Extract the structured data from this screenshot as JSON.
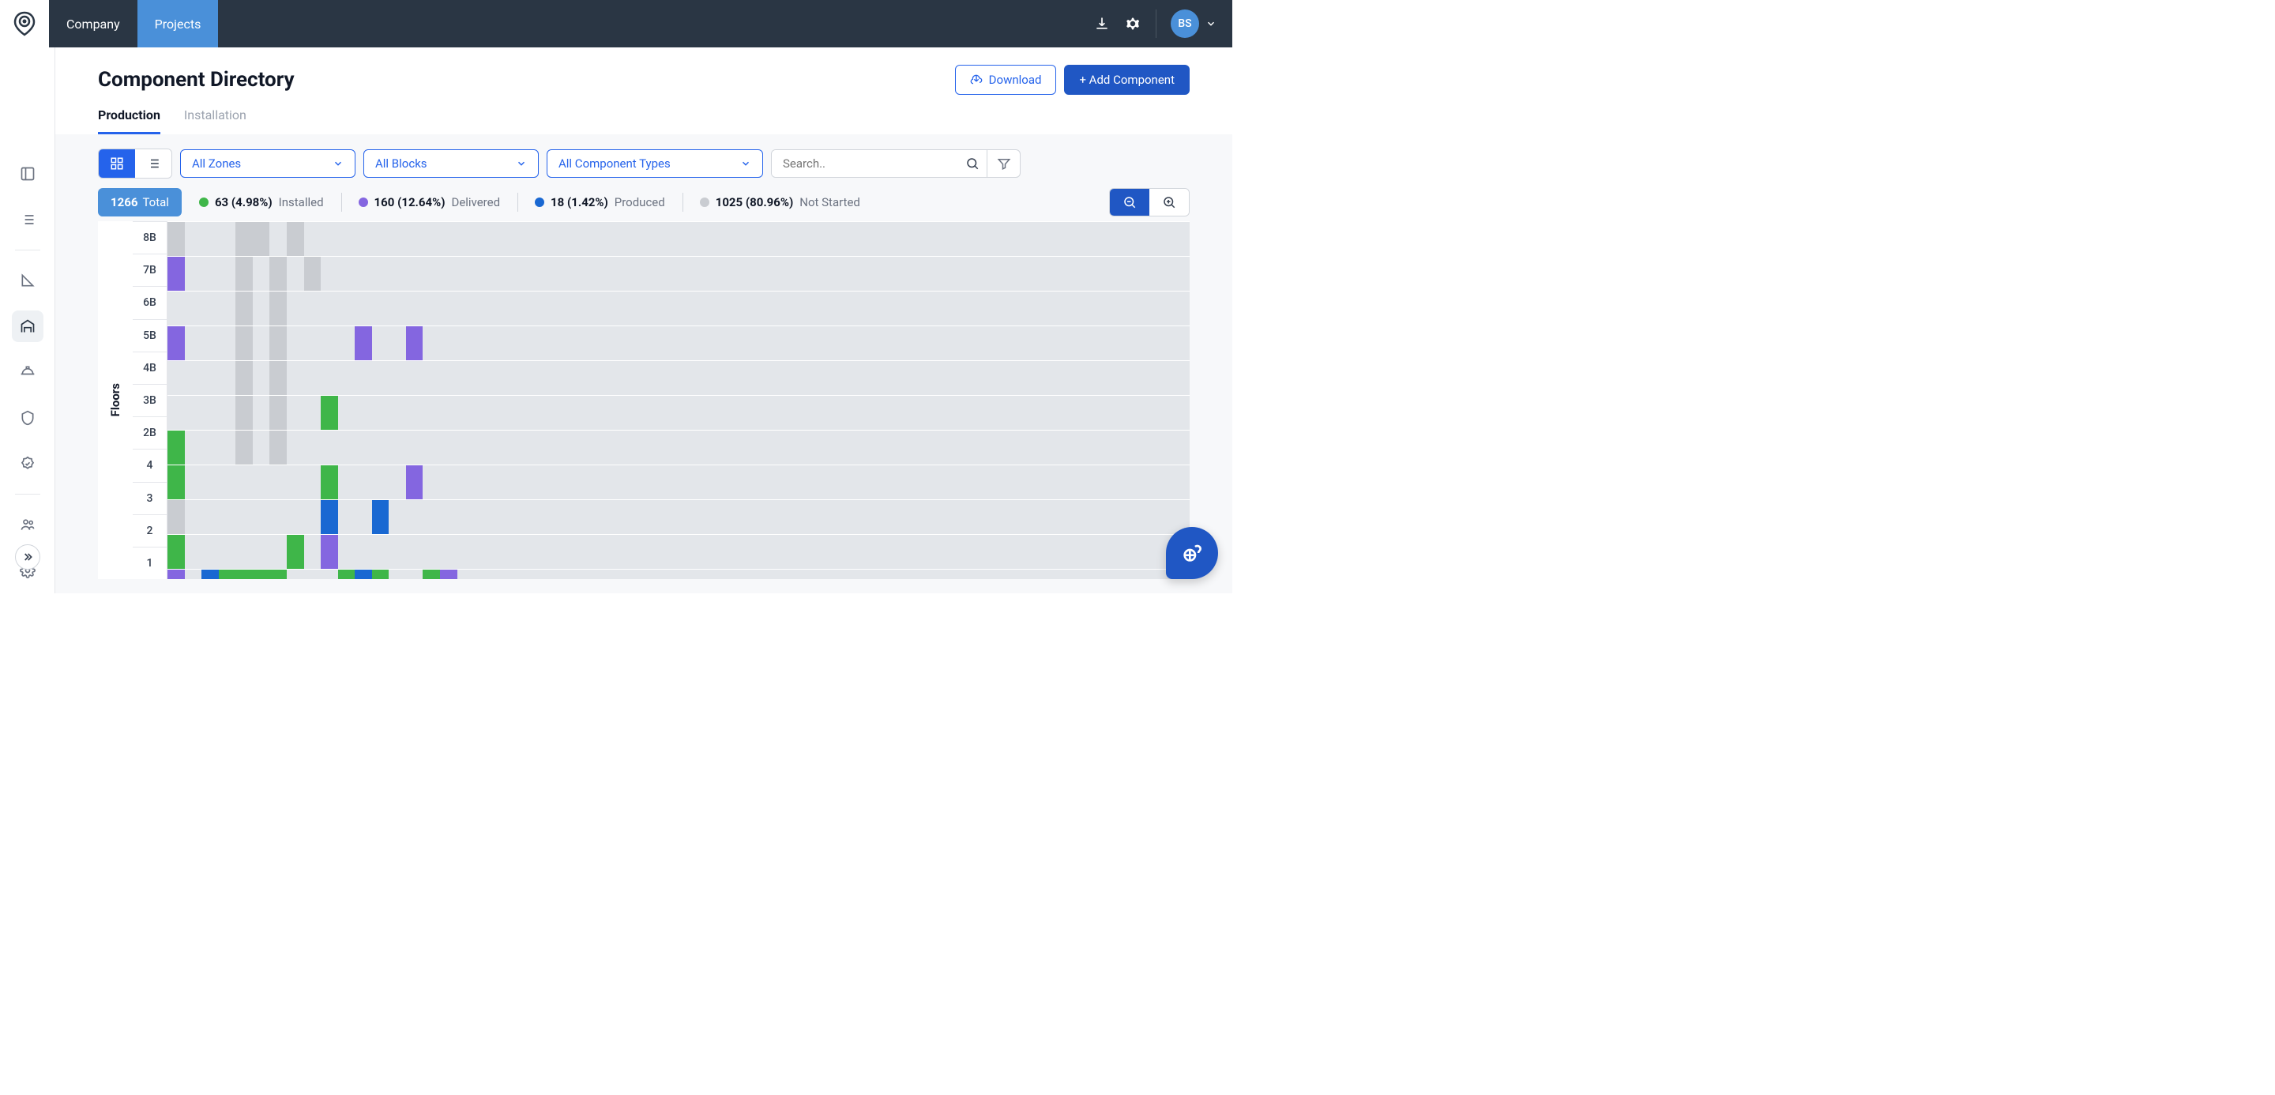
{
  "colors": {
    "installed": "#3fb649",
    "delivered": "#8466e0",
    "produced": "#1968d2",
    "notstarted": "#c9ccd1"
  },
  "nav": {
    "company": "Company",
    "projects": "Projects"
  },
  "user": {
    "initials": "BS"
  },
  "page": {
    "title": "Component Directory",
    "download": "Download",
    "add": "+ Add Component"
  },
  "tabs": {
    "production": "Production",
    "installation": "Installation"
  },
  "filters": {
    "zones": "All Zones",
    "blocks": "All Blocks",
    "types": "All Component Types",
    "search_placeholder": "Search.."
  },
  "stats": {
    "total_count": "1266",
    "total_label": "Total",
    "installed_count": "63 (4.98%)",
    "installed_label": "Installed",
    "delivered_count": "160 (12.64%)",
    "delivered_label": "Delivered",
    "produced_count": "18 (1.42%)",
    "produced_label": "Produced",
    "notstarted_count": "1025 (80.96%)",
    "notstarted_label": "Not Started"
  },
  "chart_data": {
    "type": "heatmap",
    "ylabel": "Floors",
    "floors": [
      "8B",
      "7B",
      "6B",
      "5B",
      "4B",
      "3B",
      "2B",
      "4",
      "3",
      "2",
      "1"
    ],
    "status_colors": {
      "I": "installed",
      "D": "delivered",
      "P": "produced",
      "N": "notstarted"
    },
    "rows": {
      "8B": [
        {
          "col": 1,
          "k": "N"
        },
        {
          "col": 5,
          "k": "N"
        },
        {
          "col": 6,
          "k": "N"
        },
        {
          "col": 8,
          "k": "N"
        }
      ],
      "7B": [
        {
          "col": 1,
          "k": "D"
        },
        {
          "col": 5,
          "k": "N"
        },
        {
          "col": 7,
          "k": "N"
        },
        {
          "col": 9,
          "k": "N"
        }
      ],
      "6B": [
        {
          "col": 5,
          "k": "N"
        },
        {
          "col": 7,
          "k": "N"
        }
      ],
      "5B": [
        {
          "col": 1,
          "k": "D"
        },
        {
          "col": 5,
          "k": "N"
        },
        {
          "col": 7,
          "k": "N"
        },
        {
          "col": 12,
          "k": "D"
        },
        {
          "col": 15,
          "k": "D"
        }
      ],
      "4B": [
        {
          "col": 5,
          "k": "N"
        },
        {
          "col": 7,
          "k": "N"
        }
      ],
      "3B": [
        {
          "col": 5,
          "k": "N"
        },
        {
          "col": 7,
          "k": "N"
        },
        {
          "col": 10,
          "k": "I"
        }
      ],
      "2B": [
        {
          "col": 1,
          "k": "I"
        },
        {
          "col": 5,
          "k": "N"
        },
        {
          "col": 7,
          "k": "N"
        }
      ],
      "4": [
        {
          "col": 1,
          "k": "I"
        },
        {
          "col": 10,
          "k": "I"
        },
        {
          "col": 15,
          "k": "D"
        }
      ],
      "3": [
        {
          "col": 1,
          "k": "N"
        },
        {
          "col": 10,
          "k": "P"
        },
        {
          "col": 13,
          "k": "P"
        }
      ],
      "2": [
        {
          "col": 1,
          "k": "I"
        },
        {
          "col": 8,
          "k": "I"
        },
        {
          "col": 10,
          "k": "D"
        }
      ],
      "1": [
        {
          "col": 1,
          "k": "D"
        },
        {
          "col": 3,
          "k": "P"
        },
        {
          "col": 4,
          "k": "I"
        },
        {
          "col": 5,
          "k": "I"
        },
        {
          "col": 6,
          "k": "I"
        },
        {
          "col": 7,
          "k": "I"
        },
        {
          "col": 11,
          "k": "I"
        },
        {
          "col": 12,
          "k": "P"
        },
        {
          "col": 13,
          "k": "I"
        },
        {
          "col": 16,
          "k": "I"
        },
        {
          "col": 17,
          "k": "D"
        }
      ]
    }
  }
}
